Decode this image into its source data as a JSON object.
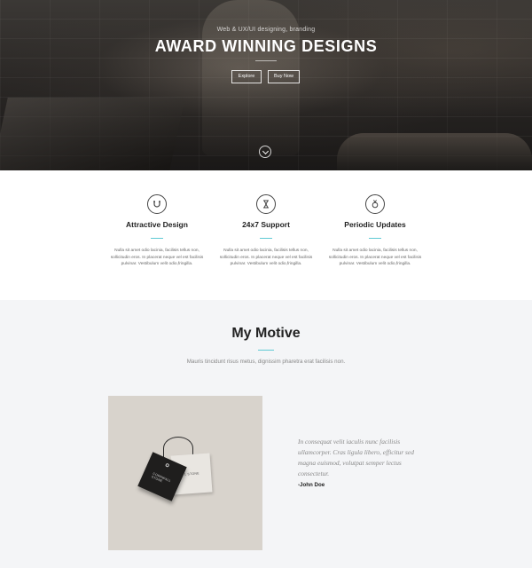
{
  "hero": {
    "subtitle": "Web & UX/UI designing, branding",
    "title": "AWARD WINNING DESIGNS",
    "buttons": {
      "explore": "Explore",
      "buy": "Buy Now"
    },
    "scroll_icon": "chevron-down-circle-icon"
  },
  "features": [
    {
      "icon": "magnet-icon",
      "title": "Attractive Design",
      "text": "Nulla sit amet odio lacinia, facilisis tellus non, sollicitudin eros. In placerat neque vel est facilisis pulvinar. Vestibulum velit odio,fringilla."
    },
    {
      "icon": "hourglass-icon",
      "title": "24x7 Support",
      "text": "Nulla sit amet odio lacinia, facilisis tellus non, sollicitudin eros. In placerat neque vel est facilisis pulvinar. Vestibulum velit odio,fringilla."
    },
    {
      "icon": "medal-icon",
      "title": "Periodic Updates",
      "text": "Nulla sit amet odio lacinia, facilisis tellus non, sollicitudin eros. In placerat neque vel est facilisis pulvinar. Vestibulum velit odio,fringilla."
    }
  ],
  "motive": {
    "title": "My Motive",
    "text": "Mauris tincidunt risus metus, dignissim pharetra erat facilisis non.",
    "photo_brand_back": "L STONE",
    "photo_brand_front": "CORNWALL STONE",
    "quote": "In consequat velit iaculis nunc facilisis ullamcorper. Cras ligula libero, efficitur sed magna euismod, volutpat semper lectus consectetur.",
    "author": "-John Doe"
  },
  "colors": {
    "accent": "#5fc9d4",
    "hero_dark": "#1a1817",
    "section_bg": "#f4f5f7",
    "heading": "#222222"
  }
}
